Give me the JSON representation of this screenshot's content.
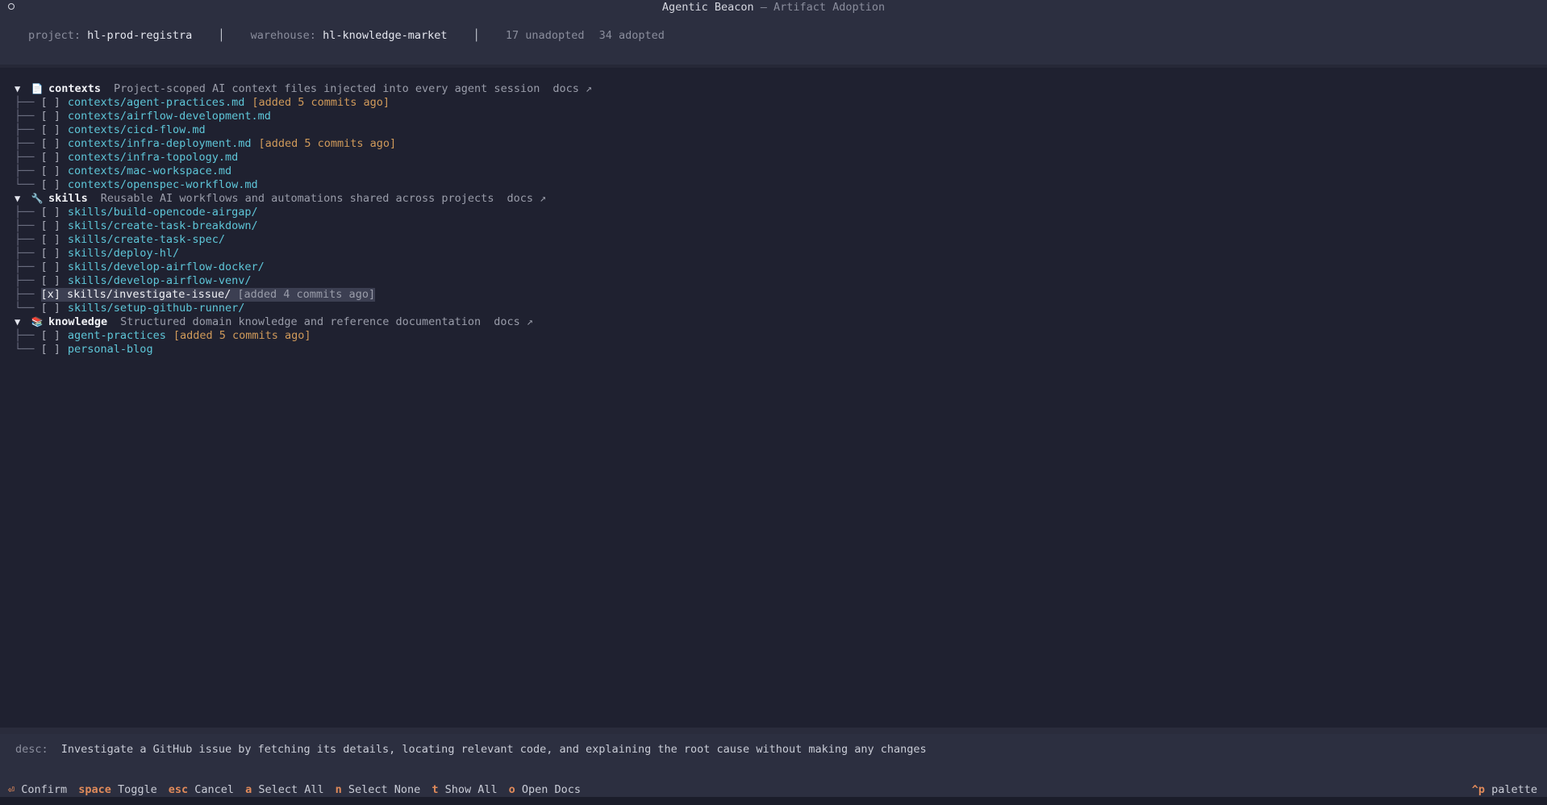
{
  "window": {
    "title_main": "Agentic Beacon",
    "title_sep": " — ",
    "title_sub": "Artifact Adoption"
  },
  "header": {
    "project_label": "project:",
    "project_value": "hl-prod-registra",
    "warehouse_label": "warehouse:",
    "warehouse_value": "hl-knowledge-market",
    "unadopted": "17 unadopted",
    "adopted": "34 adopted"
  },
  "categories": [
    {
      "caret": "▼",
      "icon": "📄",
      "icon_name": "document-icon",
      "name": "contexts",
      "desc": "Project-scoped AI context files injected into every agent session",
      "docs": "docs ↗",
      "items": [
        {
          "check": "[ ]",
          "label": "contexts/agent-practices.md",
          "badge": "[added 5 commits ago]"
        },
        {
          "check": "[ ]",
          "label": "contexts/airflow-development.md",
          "badge": ""
        },
        {
          "check": "[ ]",
          "label": "contexts/cicd-flow.md",
          "badge": ""
        },
        {
          "check": "[ ]",
          "label": "contexts/infra-deployment.md",
          "badge": "[added 5 commits ago]"
        },
        {
          "check": "[ ]",
          "label": "contexts/infra-topology.md",
          "badge": ""
        },
        {
          "check": "[ ]",
          "label": "contexts/mac-workspace.md",
          "badge": ""
        },
        {
          "check": "[ ]",
          "label": "contexts/openspec-workflow.md",
          "badge": ""
        }
      ]
    },
    {
      "caret": "▼",
      "icon": "🔧",
      "icon_name": "wrench-icon",
      "name": "skills",
      "desc": "Reusable AI workflows and automations shared across projects",
      "docs": "docs ↗",
      "items": [
        {
          "check": "[ ]",
          "label": "skills/build-opencode-airgap/",
          "badge": ""
        },
        {
          "check": "[ ]",
          "label": "skills/create-task-breakdown/",
          "badge": ""
        },
        {
          "check": "[ ]",
          "label": "skills/create-task-spec/",
          "badge": ""
        },
        {
          "check": "[ ]",
          "label": "skills/deploy-hl/",
          "badge": ""
        },
        {
          "check": "[ ]",
          "label": "skills/develop-airflow-docker/",
          "badge": ""
        },
        {
          "check": "[ ]",
          "label": "skills/develop-airflow-venv/",
          "badge": ""
        },
        {
          "check": "[x]",
          "label": "skills/investigate-issue/",
          "badge": "[added 4 commits ago]",
          "selected": true
        },
        {
          "check": "[ ]",
          "label": "skills/setup-github-runner/",
          "badge": ""
        }
      ]
    },
    {
      "caret": "▼",
      "icon": "📚",
      "icon_name": "books-icon",
      "name": "knowledge",
      "desc": "Structured domain knowledge and reference documentation",
      "docs": "docs ↗",
      "items": [
        {
          "check": "[ ]",
          "label": "agent-practices",
          "badge": "[added 5 commits ago]"
        },
        {
          "check": "[ ]",
          "label": "personal-blog",
          "badge": ""
        }
      ]
    }
  ],
  "description": {
    "label": "desc:",
    "text": "Investigate a GitHub issue by fetching its details, locating relevant code, and explaining the root cause without making any changes"
  },
  "footer": {
    "bindings": [
      {
        "key": "⏎",
        "label": "Confirm"
      },
      {
        "key": "space",
        "label": "Toggle"
      },
      {
        "key": "esc",
        "label": "Cancel"
      },
      {
        "key": "a",
        "label": "Select All"
      },
      {
        "key": "n",
        "label": "Select None"
      },
      {
        "key": "t",
        "label": "Show All"
      },
      {
        "key": "o",
        "label": "Open Docs"
      }
    ],
    "palette_key": "^p",
    "palette_label": "palette"
  }
}
